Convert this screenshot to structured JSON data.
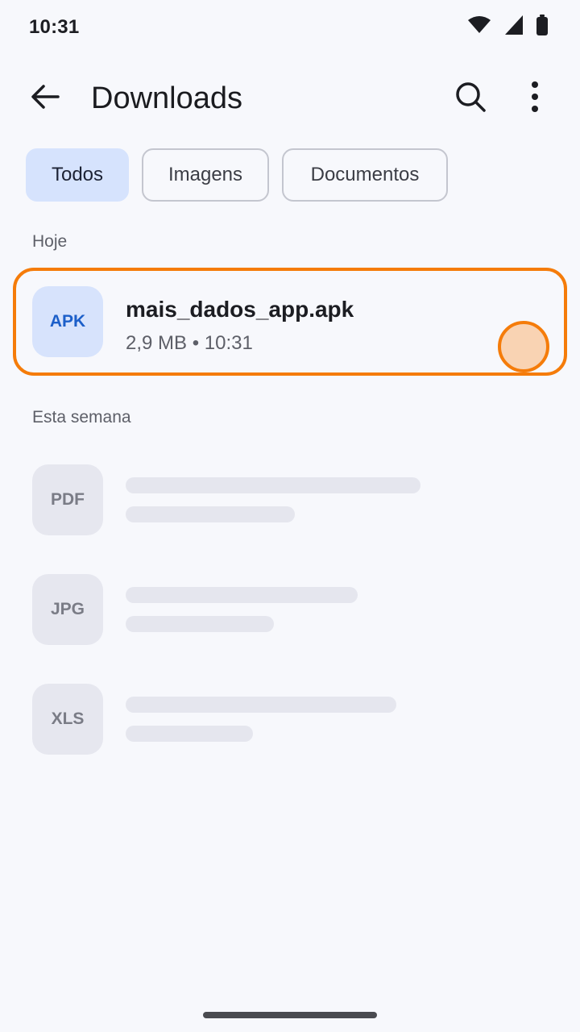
{
  "status_bar": {
    "time": "10:31",
    "icons": [
      "wifi-icon",
      "cell-signal-icon",
      "battery-icon"
    ]
  },
  "app_bar": {
    "title": "Downloads",
    "back_icon": "arrow-left-icon",
    "search_icon": "search-icon",
    "more_icon": "more-vertical-icon"
  },
  "filters": {
    "chips": [
      {
        "label": "Todos",
        "selected": true
      },
      {
        "label": "Imagens",
        "selected": false
      },
      {
        "label": "Documentos",
        "selected": false
      }
    ]
  },
  "sections": {
    "today": {
      "header": "Hoje",
      "items": [
        {
          "type_label": "APK",
          "name": "mais_dados_app.apk",
          "meta": "2,9 MB • 10:31"
        }
      ]
    },
    "this_week": {
      "header": "Esta semana",
      "items": [
        {
          "type_label": "PDF",
          "loading": true
        },
        {
          "type_label": "JPG",
          "loading": true
        },
        {
          "type_label": "XLS",
          "loading": true
        }
      ]
    }
  },
  "colors": {
    "accent": "#f57c0a",
    "selected_chip": "#d6e3fd",
    "apk_text": "#1c5fc9",
    "background": "#f7f8fc"
  }
}
